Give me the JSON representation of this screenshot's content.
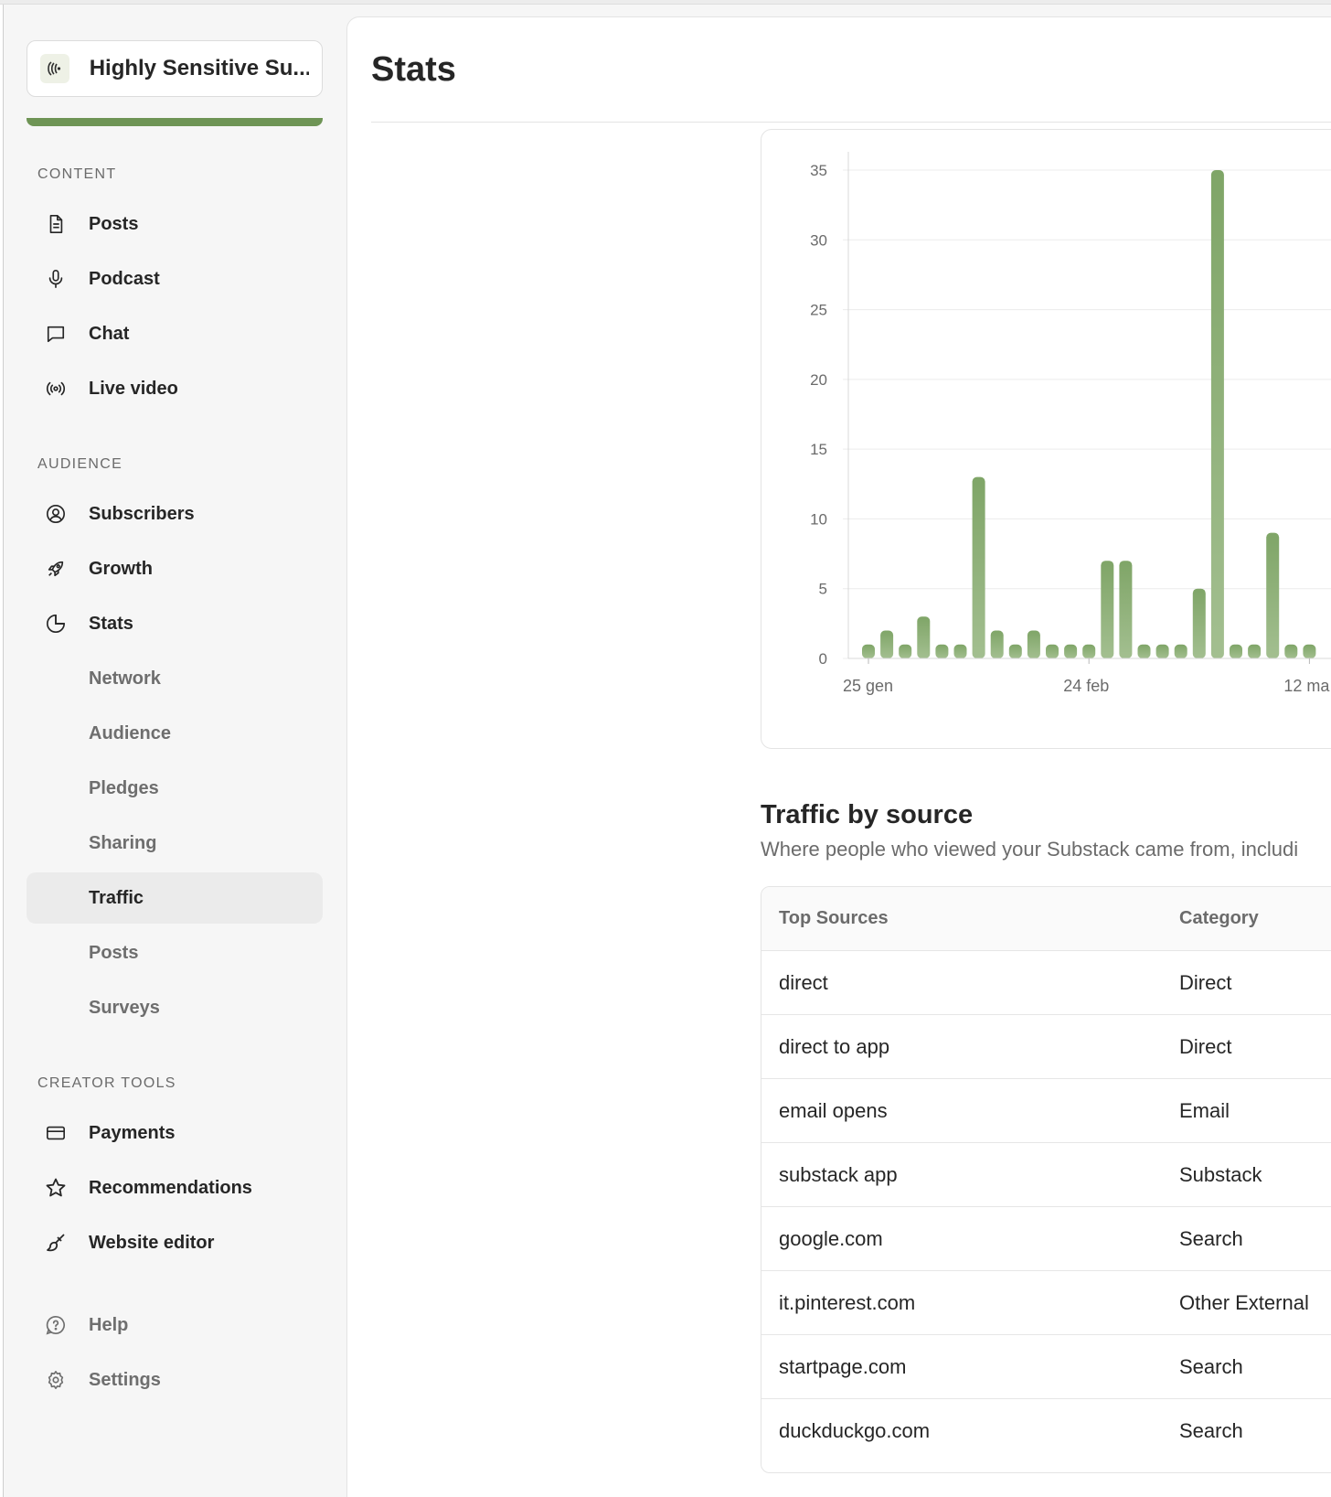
{
  "publication": {
    "name": "Highly Sensitive Su..."
  },
  "sidebar": {
    "content_label": "CONTENT",
    "content_items": [
      {
        "label": "Posts",
        "icon": "document-icon"
      },
      {
        "label": "Podcast",
        "icon": "microphone-icon"
      },
      {
        "label": "Chat",
        "icon": "chat-bubble-icon"
      },
      {
        "label": "Live video",
        "icon": "broadcast-icon"
      }
    ],
    "audience_label": "AUDIENCE",
    "audience_items": [
      {
        "label": "Subscribers",
        "icon": "user-circle-icon"
      },
      {
        "label": "Growth",
        "icon": "rocket-icon"
      },
      {
        "label": "Stats",
        "icon": "pie-chart-icon"
      }
    ],
    "stats_subitems": [
      {
        "label": "Network"
      },
      {
        "label": "Audience"
      },
      {
        "label": "Pledges"
      },
      {
        "label": "Sharing"
      },
      {
        "label": "Traffic",
        "active": true
      },
      {
        "label": "Posts"
      },
      {
        "label": "Surveys"
      }
    ],
    "creator_label": "CREATOR TOOLS",
    "creator_items": [
      {
        "label": "Payments",
        "icon": "credit-card-icon"
      },
      {
        "label": "Recommendations",
        "icon": "star-icon"
      },
      {
        "label": "Website editor",
        "icon": "paintbrush-icon"
      }
    ],
    "footer_items": [
      {
        "label": "Help",
        "icon": "help-bubble-icon"
      },
      {
        "label": "Settings",
        "icon": "gear-icon"
      }
    ]
  },
  "main": {
    "title": "Stats"
  },
  "chart_data": {
    "type": "bar",
    "x_tick_labels": [
      "25 gen",
      "24 feb",
      "12 ma"
    ],
    "x_tick_indices": [
      0,
      12,
      24
    ],
    "values": [
      1,
      2,
      1,
      3,
      1,
      1,
      13,
      2,
      1,
      2,
      1,
      1,
      1,
      7,
      7,
      1,
      1,
      1,
      5,
      35,
      1,
      1,
      9,
      1,
      1
    ],
    "y_ticks": [
      0,
      5,
      10,
      15,
      20,
      25,
      30,
      35
    ],
    "ylim": [
      0,
      35
    ],
    "grid": true,
    "bar_color": "#7fa567"
  },
  "traffic": {
    "heading": "Traffic by source",
    "description": "Where people who viewed your Substack came from, includi",
    "columns": {
      "source": "Top Sources",
      "category": "Category"
    },
    "rows": [
      {
        "source": "direct",
        "category": "Direct"
      },
      {
        "source": "direct to app",
        "category": "Direct"
      },
      {
        "source": "email opens",
        "category": "Email"
      },
      {
        "source": "substack app",
        "category": "Substack"
      },
      {
        "source": "google.com",
        "category": "Search"
      },
      {
        "source": "it.pinterest.com",
        "category": "Other External"
      },
      {
        "source": "startpage.com",
        "category": "Search"
      },
      {
        "source": "duckduckgo.com",
        "category": "Search"
      }
    ]
  },
  "colors": {
    "accent_green": "#6e9455",
    "bar_green": "#7fa567"
  }
}
